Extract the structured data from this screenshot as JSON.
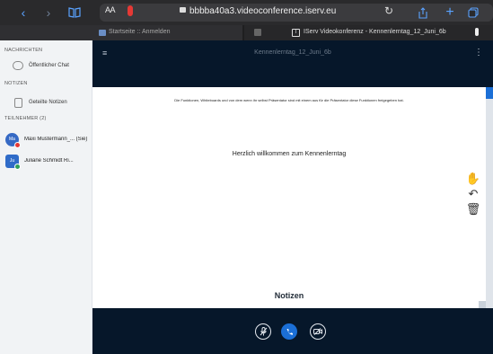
{
  "browser": {
    "text_size_label": "AA",
    "url": "bbbba40a3.videoconference.iserv.eu",
    "icons": [
      "back-icon",
      "forward-icon",
      "bookmarks-icon",
      "mic-indicator-icon",
      "lock-icon",
      "reload-icon",
      "share-icon",
      "new-tab-icon",
      "tabs-icon"
    ]
  },
  "tabs": [
    {
      "title": "Startseite :: Anmelden"
    },
    {
      "title": "IServ Videokonferenz - Kennenlerntag_12_Juni_6b"
    }
  ],
  "sidebar": {
    "messages_title": "NACHRICHTEN",
    "public_chat": "Öffentlicher Chat",
    "notes_title": "NOTIZEN",
    "shared_notes": "Geteilte Notizen",
    "participants_title": "TEILNEHMER (2)",
    "users": [
      {
        "initials": "Ma",
        "name": "Maxi Muster­mann_... (Sie)",
        "color": "#3569c4",
        "status_color": "#e53935"
      },
      {
        "initials": "Ju",
        "name": "Juliane Schmidt Ri...",
        "color": "#2f6bc8",
        "status_color": "#2e9e5b"
      }
    ]
  },
  "main": {
    "meeting_title": "Kennenlerntag_12_Juni_6b",
    "slide_text": "Die Funktionen, Whiteboards und von dem wenn ihr selbst Präsentator sind mit einem aus für die Präsentator diese Funktionen freigegeben hat.",
    "slide_heading": "Herzlich willkommen zum Kennenlerntag",
    "notes_label": "Notizen"
  },
  "colors": {
    "accent": "#1b6fd6",
    "main_bg": "#06172a",
    "sidebar_bg": "#f1f3f5"
  }
}
